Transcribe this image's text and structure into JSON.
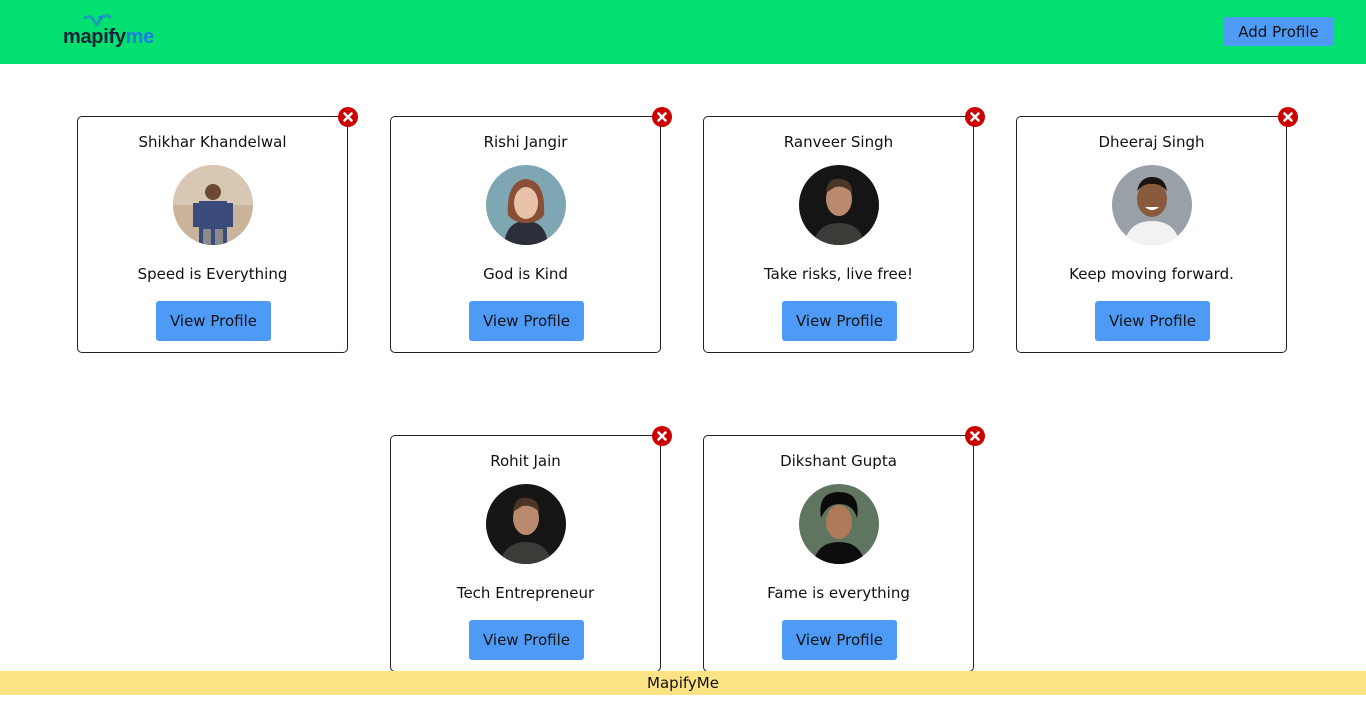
{
  "header": {
    "logo": {
      "text_a": "mapify",
      "text_b": "me"
    },
    "add_profile_label": "Add Profile"
  },
  "profiles": [
    {
      "name": "Shikhar Khandelwal",
      "quote": "Speed is Everything",
      "button": "View Profile"
    },
    {
      "name": "Rishi Jangir",
      "quote": "God is Kind",
      "button": "View Profile"
    },
    {
      "name": "Ranveer Singh",
      "quote": "Take risks, live free!",
      "button": "View Profile"
    },
    {
      "name": "Dheeraj Singh",
      "quote": "Keep moving forward.",
      "button": "View Profile"
    },
    {
      "name": "Rohit Jain",
      "quote": "Tech Entrepreneur",
      "button": "View Profile"
    },
    {
      "name": "Dikshant Gupta",
      "quote": "Fame is everything",
      "button": "View Profile"
    }
  ],
  "footer": {
    "text": "MapifyMe"
  },
  "colors": {
    "header_bg": "#02e06f",
    "button_bg": "#4d9bf6",
    "close_bg": "#cc0000",
    "footer_bg": "#fde383"
  }
}
